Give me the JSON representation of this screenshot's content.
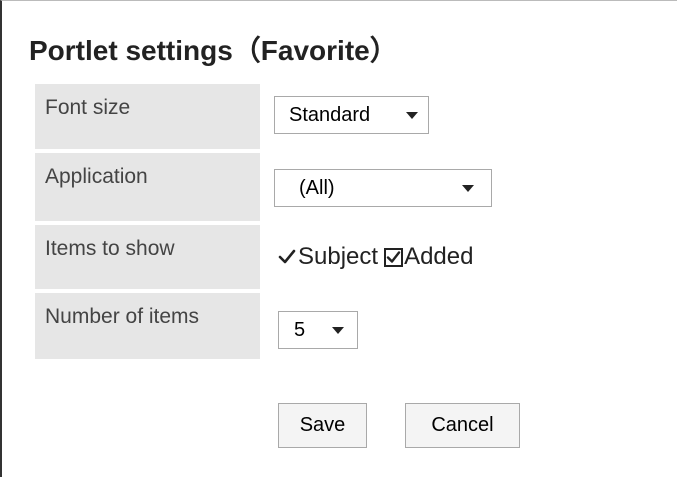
{
  "title": "Portlet settings（Favorite）",
  "rows": {
    "font_size": {
      "label": "Font size",
      "value": "Standard"
    },
    "application": {
      "label": "Application",
      "value": "(All)"
    },
    "items_to_show": {
      "label": "Items to show",
      "options": [
        {
          "label": "Subject",
          "checked": true,
          "style": "checkmark"
        },
        {
          "label": "Added",
          "checked": true,
          "style": "checkbox"
        }
      ]
    },
    "number_of_items": {
      "label": "Number of items",
      "value": "5"
    }
  },
  "buttons": {
    "save": "Save",
    "cancel": "Cancel"
  },
  "icons": {
    "dropdown": "chevron-down-icon",
    "check": "check-icon",
    "checkbox": "checkbox-checked-icon"
  }
}
